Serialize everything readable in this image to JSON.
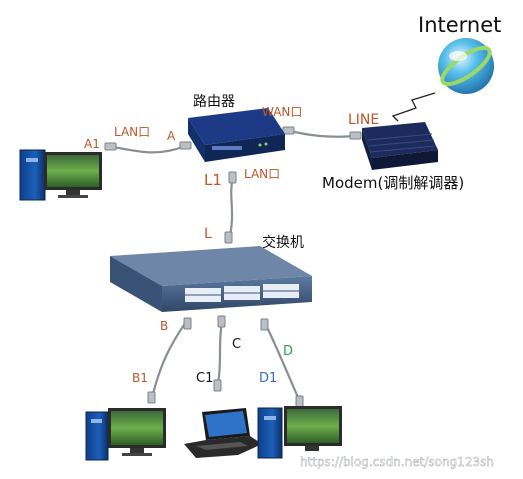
{
  "internet": {
    "label": "Internet"
  },
  "router": {
    "label": "路由器",
    "wan_port": "WAN口",
    "lan_port_left": "LAN口",
    "lan_port_bottom": "LAN口"
  },
  "modem": {
    "label": "Modem(调制解调器)",
    "line": "LINE"
  },
  "switch": {
    "label": "交换机"
  },
  "cable_labels": {
    "a": "A",
    "a1": "A1",
    "l": "L",
    "l1": "L1",
    "b": "B",
    "b1": "B1",
    "c": "C",
    "c1": "C1",
    "d": "D",
    "d1": "D1"
  },
  "watermark": "https://blog.csdn.net/song123sh",
  "colors": {
    "orange": "#c0562a",
    "blue": "#2f74b8",
    "green": "#3c9a52",
    "cable": "#8a8f94"
  }
}
